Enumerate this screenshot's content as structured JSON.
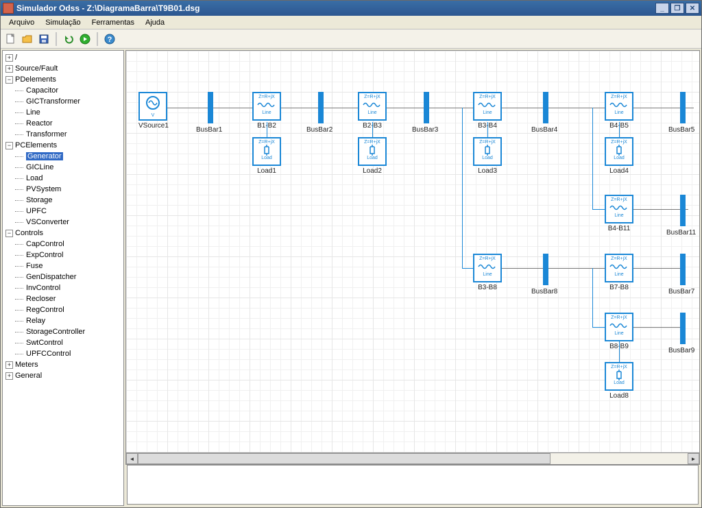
{
  "title": "Simulador Odss - Z:\\DiagramaBarra\\T9B01.dsg",
  "menu": {
    "file": "Arquivo",
    "sim": "Simulação",
    "tools": "Ferramentas",
    "help": "Ajuda"
  },
  "toolbar": {
    "new": "new",
    "open": "open",
    "save": "save",
    "sep": "",
    "undo": "undo",
    "run": "run",
    "help": "help"
  },
  "tree": {
    "root": "/",
    "sourcefault": "Source/Fault",
    "pdelements": "PDelements",
    "pd": {
      "capacitor": "Capacitor",
      "gictrans": "GICTransformer",
      "line": "Line",
      "reactor": "Reactor",
      "transformer": "Transformer"
    },
    "pcelements": "PCElements",
    "pc": {
      "generator": "Generator",
      "gicline": "GICLine",
      "load": "Load",
      "pvsystem": "PVSystem",
      "storage": "Storage",
      "upfc": "UPFC",
      "vsconverter": "VSConverter"
    },
    "controls": "Controls",
    "ct": {
      "capcontrol": "CapControl",
      "expcontrol": "ExpControl",
      "fuse": "Fuse",
      "gendispatcher": "GenDispatcher",
      "invcontrol": "InvControl",
      "recloser": "Recloser",
      "regcontrol": "RegControl",
      "relay": "Relay",
      "storagecontroller": "StorageController",
      "swtcontrol": "SwtControl",
      "upfccontrol": "UPFCControl"
    },
    "meters": "Meters",
    "general": "General"
  },
  "blk": {
    "z_label": "Z=R+jX",
    "line_label": "Line",
    "load_label": "Load",
    "vsource_label": "VSource"
  },
  "elements": {
    "vsource1": "VSource1",
    "busbar1": "BusBar1",
    "b1b2": "B1-B2",
    "load1": "Load1",
    "busbar2": "BusBar2",
    "b2b3": "B2-B3",
    "load2": "Load2",
    "busbar3": "BusBar3",
    "b3b4": "B3-B4",
    "load3": "Load3",
    "busbar4": "BusBar4",
    "b4b5": "B4-B5",
    "load4": "Load4",
    "busbar5": "BusBar5",
    "b4b11": "B4-B11",
    "busbar11": "BusBar11",
    "b3b8": "B3-B8",
    "busbar8": "BusBar8",
    "b7b8": "B7-B8",
    "busbar7": "BusBar7",
    "b8b9": "B8-B9",
    "busbar9": "BusBar9",
    "load8": "Load8"
  }
}
